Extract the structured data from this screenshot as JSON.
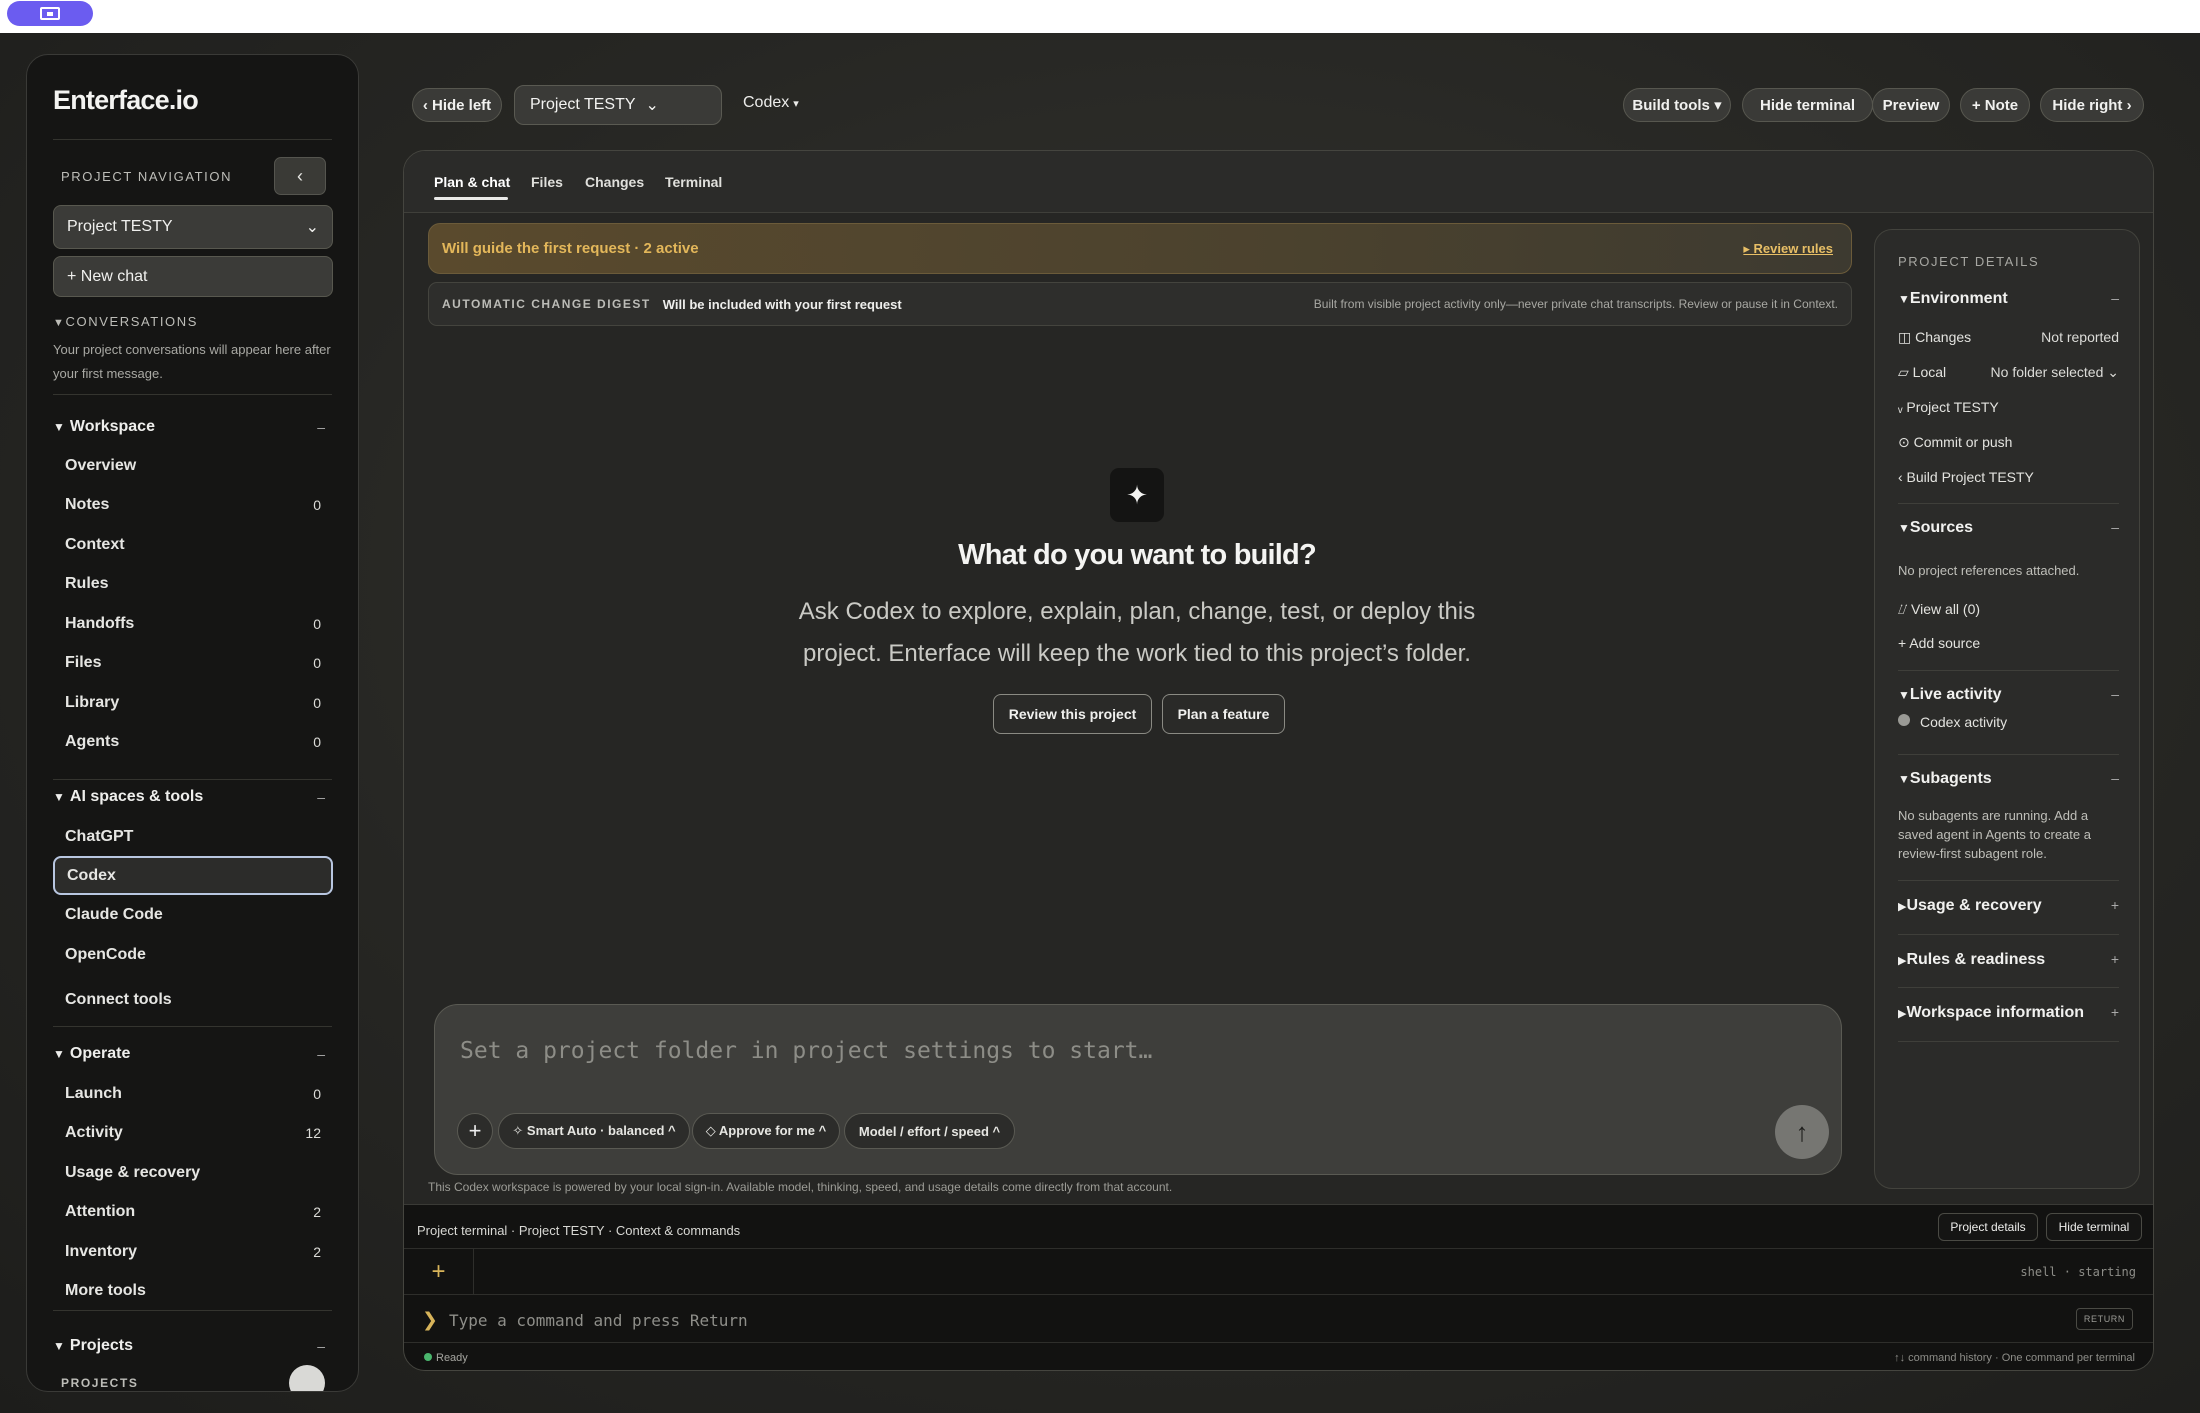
{
  "sidebar": {
    "brand": "Enterface.io",
    "nav_caption": "PROJECT NAVIGATION",
    "collapse_glyph": "‹",
    "project_select": "Project TESTY",
    "new_chat": "+ New chat",
    "conversations_caption": "CONVERSATIONS",
    "conversations_hint": "Your project conversations will appear here after your first message.",
    "workspace": {
      "title": "Workspace",
      "items": [
        {
          "label": "Overview",
          "count": ""
        },
        {
          "label": "Notes",
          "count": "0"
        },
        {
          "label": "Context",
          "count": ""
        },
        {
          "label": "Rules",
          "count": ""
        },
        {
          "label": "Handoffs",
          "count": "0"
        },
        {
          "label": "Files",
          "count": "0"
        },
        {
          "label": "Library",
          "count": "0"
        },
        {
          "label": "Agents",
          "count": "0"
        }
      ]
    },
    "ai": {
      "title": "AI spaces & tools",
      "items": [
        {
          "label": "ChatGPT"
        },
        {
          "label": "Codex",
          "active": true
        },
        {
          "label": "Claude Code"
        },
        {
          "label": "OpenCode"
        },
        {
          "label": "Connect tools"
        }
      ]
    },
    "operate": {
      "title": "Operate",
      "items": [
        {
          "label": "Launch",
          "count": "0"
        },
        {
          "label": "Activity",
          "count": "12"
        },
        {
          "label": "Usage & recovery",
          "count": ""
        },
        {
          "label": "Attention",
          "count": "2"
        },
        {
          "label": "Inventory",
          "count": "2"
        },
        {
          "label": "More tools",
          "count": ""
        }
      ]
    },
    "projects": {
      "title": "Projects",
      "caption": "PROJECTS"
    },
    "collapse_dash": "–"
  },
  "header": {
    "hide_left": "‹ Hide left",
    "project": "Project TESTY",
    "agent": "Codex",
    "build_tools": "Build tools ▾",
    "hide_terminal": "Hide terminal",
    "preview": "Preview",
    "note": "+ Note",
    "hide_right": "Hide right ›"
  },
  "tabs": [
    "Plan & chat",
    "Files",
    "Changes",
    "Terminal"
  ],
  "banners": {
    "guide": "Will guide the first request · 2 active",
    "review_rules": "▸ Review rules",
    "digest_caption": "AUTOMATIC CHANGE DIGEST",
    "digest_bold": "Will be included with your first request",
    "digest_note": "Built from visible project activity only—never private chat transcripts. Review or pause it in Context."
  },
  "hero": {
    "icon": "✦",
    "title": "What do you want to build?",
    "subtitle": "Ask Codex to explore, explain, plan, change, test, or deploy this project. Enterface will keep the work tied to this project’s folder.",
    "btn_review": "Review this project",
    "btn_plan": "Plan a feature"
  },
  "composer": {
    "placeholder": "Set a project folder in project settings to start…",
    "plus": "+",
    "chip_smart": "✧ Smart Auto · balanced ^",
    "chip_approve": "◇ Approve for me ^",
    "chip_model": "Model / effort / speed ^",
    "send": "↑",
    "note": "This Codex workspace is powered by your local sign-in. Available model, thinking, speed, and usage details come directly from that account."
  },
  "details": {
    "caption": "PROJECT DETAILS",
    "environment": "Environment",
    "env_rows": [
      {
        "label": "◫ Changes",
        "value": "Not reported"
      },
      {
        "label": "▱ Local",
        "value": "No folder selected ⌄"
      },
      {
        "label": "ᵥ Project TESTY",
        "value": ""
      },
      {
        "label": "⊙ Commit or push",
        "value": ""
      },
      {
        "label": "‹ Build Project TESTY",
        "value": ""
      }
    ],
    "sources": "Sources",
    "sources_none": "No project references attached.",
    "view_all": "⌰ View all (0)",
    "add_source": "+ Add source",
    "live": "Live activity",
    "codex_activity": "Codex activity",
    "subagents": "Subagents",
    "subagents_text": "No subagents are running. Add a saved agent in Agents to create a review-first subagent role.",
    "usage": "Usage & recovery",
    "rules": "Rules & readiness",
    "workspace_info": "Workspace information",
    "minus": "–",
    "plus": "+"
  },
  "terminal": {
    "head": "Project terminal · Project TESTY · Context & commands",
    "project_details": "Project details",
    "hide_terminal": "Hide terminal",
    "plus": "+",
    "status": "shell · starting",
    "prompt": "❯",
    "input": "Type a command and press Return",
    "return": "RETURN",
    "ready": "Ready",
    "hint": "↑↓ command history · One command per terminal"
  }
}
